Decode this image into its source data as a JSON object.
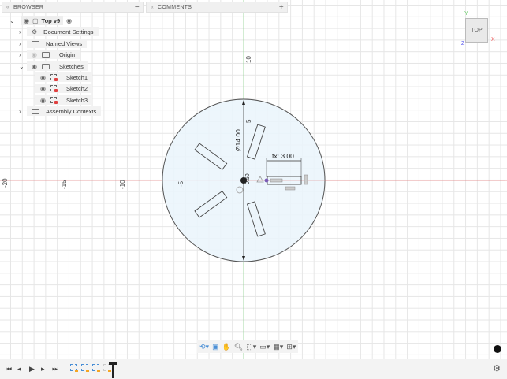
{
  "browser": {
    "title": "BROWSER",
    "collapse": "−",
    "root": "Top v9",
    "items": [
      {
        "label": "Document Settings"
      },
      {
        "label": "Named Views"
      },
      {
        "label": "Origin"
      },
      {
        "label": "Sketches"
      },
      {
        "label": "Sketch1"
      },
      {
        "label": "Sketch2"
      },
      {
        "label": "Sketch3"
      },
      {
        "label": "Assembly Contexts"
      }
    ]
  },
  "comments": {
    "title": "COMMENTS",
    "add": "+"
  },
  "viewcube": {
    "face": "TOP",
    "axes": {
      "x": "X",
      "y": "Y",
      "z": "Z"
    }
  },
  "canvas": {
    "ruler_x": [
      "-20",
      "-15",
      "-10",
      "-5"
    ],
    "ruler_y": [
      "10",
      "5"
    ],
    "dimension_diameter": "Ø14.00",
    "dimension_fx": "fx: 3.00",
    "dimension_small": "0.50"
  },
  "colors": {
    "sketch_fill": "#eaf4fb",
    "x_axis": "#e08a8a",
    "y_axis": "#8fd08f",
    "selection": "#7a5bb5"
  }
}
